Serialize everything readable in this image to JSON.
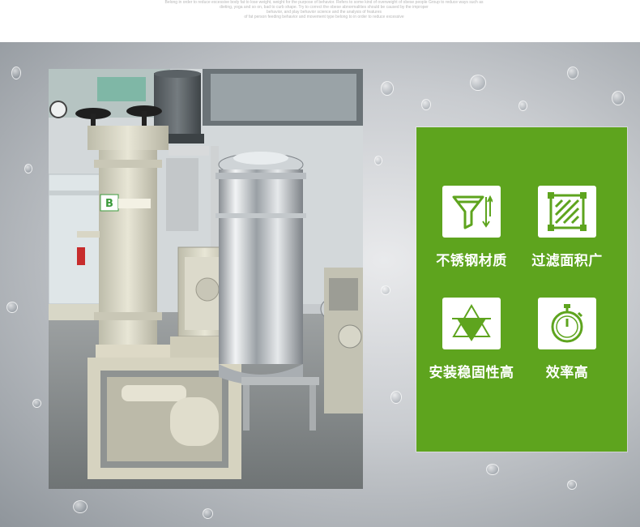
{
  "header": {
    "lines": [
      "Belong in order to reduce excessive body fat to lose weight, weight for the purpose of behavior. Refers to some kind of overweight of obese people Group to reduce ways such as",
      "dieting, yoga and so on, bad to curb shape. Try to correct the obese abnormalities should be caused by the improper",
      "behavior, and play behavior science and the analysis of features",
      "of fat person feeding behavior and movement type belong to in order to reduce excessive"
    ]
  },
  "photo": {
    "badge_text": "B"
  },
  "features": [
    {
      "label": "不锈钢材质",
      "icon": "funnel-filter-icon"
    },
    {
      "label": "过滤面积广",
      "icon": "filter-area-icon"
    },
    {
      "label": "安装稳固性高",
      "icon": "stable-triangle-icon"
    },
    {
      "label": "效率高",
      "icon": "stopwatch-icon"
    }
  ],
  "colors": {
    "feature_panel": "#5ea41e",
    "icon_green": "#5ea41e",
    "background": "#b9bec3"
  }
}
